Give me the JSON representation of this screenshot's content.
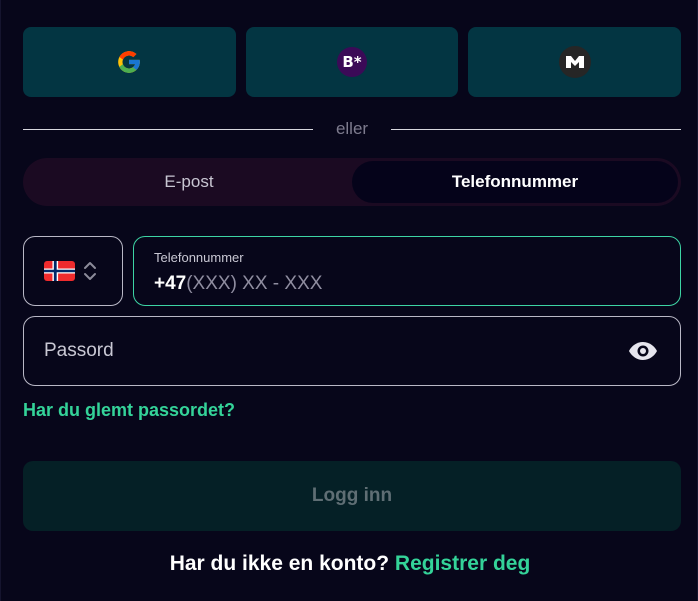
{
  "social_logins": [
    {
      "provider": "google",
      "icon": "google-icon"
    },
    {
      "provider": "bplus",
      "icon": "bplus-icon",
      "label": "B*"
    },
    {
      "provider": "m",
      "icon": "m-logo-icon"
    }
  ],
  "divider": {
    "text": "eller"
  },
  "tabs": [
    {
      "label": "E-post",
      "active": false
    },
    {
      "label": "Telefonnummer",
      "active": true
    }
  ],
  "country_select": {
    "flag": "norway-flag-icon",
    "arrows": "updown-chevron-icon"
  },
  "phone_field": {
    "label": "Telefonnummer",
    "prefix": "+47",
    "placeholder": "(XXX) XX - XXX"
  },
  "password_field": {
    "placeholder": "Passord",
    "toggle_icon": "eye-icon"
  },
  "forgot_password": "Har du glemt passordet?",
  "login_button": "Logg inn",
  "register": {
    "question": "Har du ikke en konto?",
    "link": "Registrer deg"
  },
  "colors": {
    "background": "#07061a",
    "social_button": "#033542",
    "accent": "#34d399",
    "login_disabled": "#052026"
  }
}
